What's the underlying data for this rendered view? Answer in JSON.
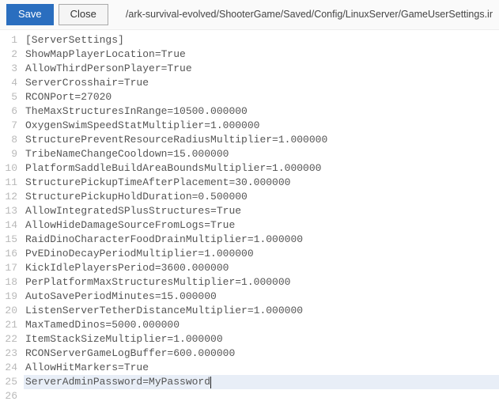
{
  "toolbar": {
    "save_label": "Save",
    "close_label": "Close",
    "file_path": "/ark-survival-evolved/ShooterGame/Saved/Config/LinuxServer/GameUserSettings.ini"
  },
  "editor": {
    "active_line": 25,
    "lines": [
      "[ServerSettings]",
      "ShowMapPlayerLocation=True",
      "AllowThirdPersonPlayer=True",
      "ServerCrosshair=True",
      "RCONPort=27020",
      "TheMaxStructuresInRange=10500.000000",
      "OxygenSwimSpeedStatMultiplier=1.000000",
      "StructurePreventResourceRadiusMultiplier=1.000000",
      "TribeNameChangeCooldown=15.000000",
      "PlatformSaddleBuildAreaBoundsMultiplier=1.000000",
      "StructurePickupTimeAfterPlacement=30.000000",
      "StructurePickupHoldDuration=0.500000",
      "AllowIntegratedSPlusStructures=True",
      "AllowHideDamageSourceFromLogs=True",
      "RaidDinoCharacterFoodDrainMultiplier=1.000000",
      "PvEDinoDecayPeriodMultiplier=1.000000",
      "KickIdlePlayersPeriod=3600.000000",
      "PerPlatformMaxStructuresMultiplier=1.000000",
      "AutoSavePeriodMinutes=15.000000",
      "ListenServerTetherDistanceMultiplier=1.000000",
      "MaxTamedDinos=5000.000000",
      "ItemStackSizeMultiplier=1.000000",
      "RCONServerGameLogBuffer=600.000000",
      "AllowHitMarkers=True",
      "ServerAdminPassword=MyPassword",
      ""
    ]
  }
}
